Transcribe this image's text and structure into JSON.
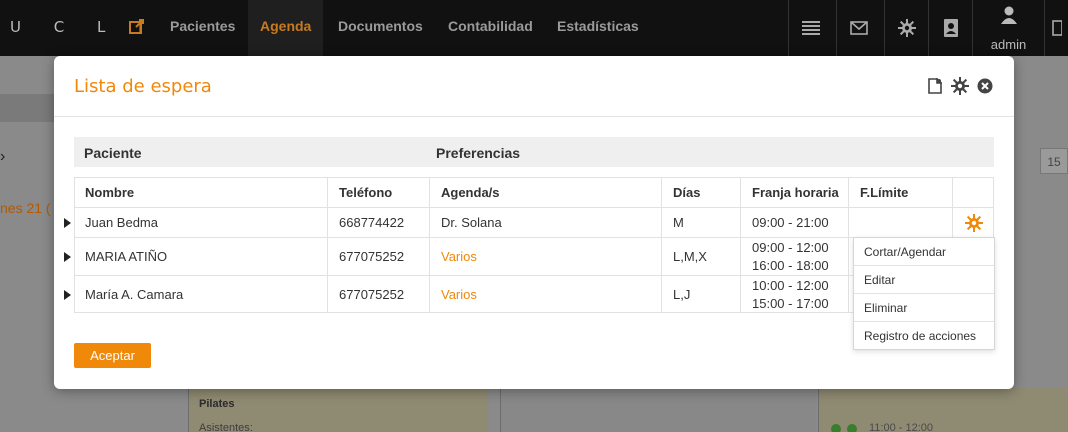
{
  "navbar": {
    "brand": "U C L I",
    "items": [
      "Pacientes",
      "Agenda",
      "Documentos",
      "Contabilidad",
      "Estadísticas"
    ],
    "active": "Agenda",
    "user": "admin"
  },
  "background": {
    "date_fragment": "nes 21 (",
    "day_badge": "15",
    "panel_title": "Pilates",
    "panel_sub": "Asistentes:",
    "time_fragment": "11:00 - 12:00"
  },
  "modal": {
    "title": "Lista de espera",
    "section_headers": {
      "patient": "Paciente",
      "preferences": "Preferencias"
    },
    "columns": [
      "Nombre",
      "Teléfono",
      "Agenda/s",
      "Días",
      "Franja horaria",
      "F.Límite"
    ],
    "rows": [
      {
        "name": "Juan Bedma",
        "phone": "668774422",
        "agenda": "Dr. Solana",
        "days": "M",
        "slots": [
          "09:00 - 21:00"
        ],
        "limit": ""
      },
      {
        "name": "MARIA ATIÑO",
        "phone": "677075252",
        "agenda": "Varios",
        "days": "L,M,X",
        "slots": [
          "09:00 - 12:00",
          "16:00 - 18:00"
        ],
        "limit": ""
      },
      {
        "name": "María A. Camara",
        "phone": "677075252",
        "agenda": "Varios",
        "days": "L,J",
        "slots": [
          "10:00 - 12:00",
          "15:00 - 17:00"
        ],
        "limit": ""
      }
    ],
    "context_menu": [
      "Cortar/Agendar",
      "Editar",
      "Eliminar",
      "Registro de acciones"
    ],
    "accept_label": "Aceptar"
  },
  "colors": {
    "accent": "#f0880a",
    "navbar": "#111111",
    "overlay": "#8a8a8a"
  }
}
